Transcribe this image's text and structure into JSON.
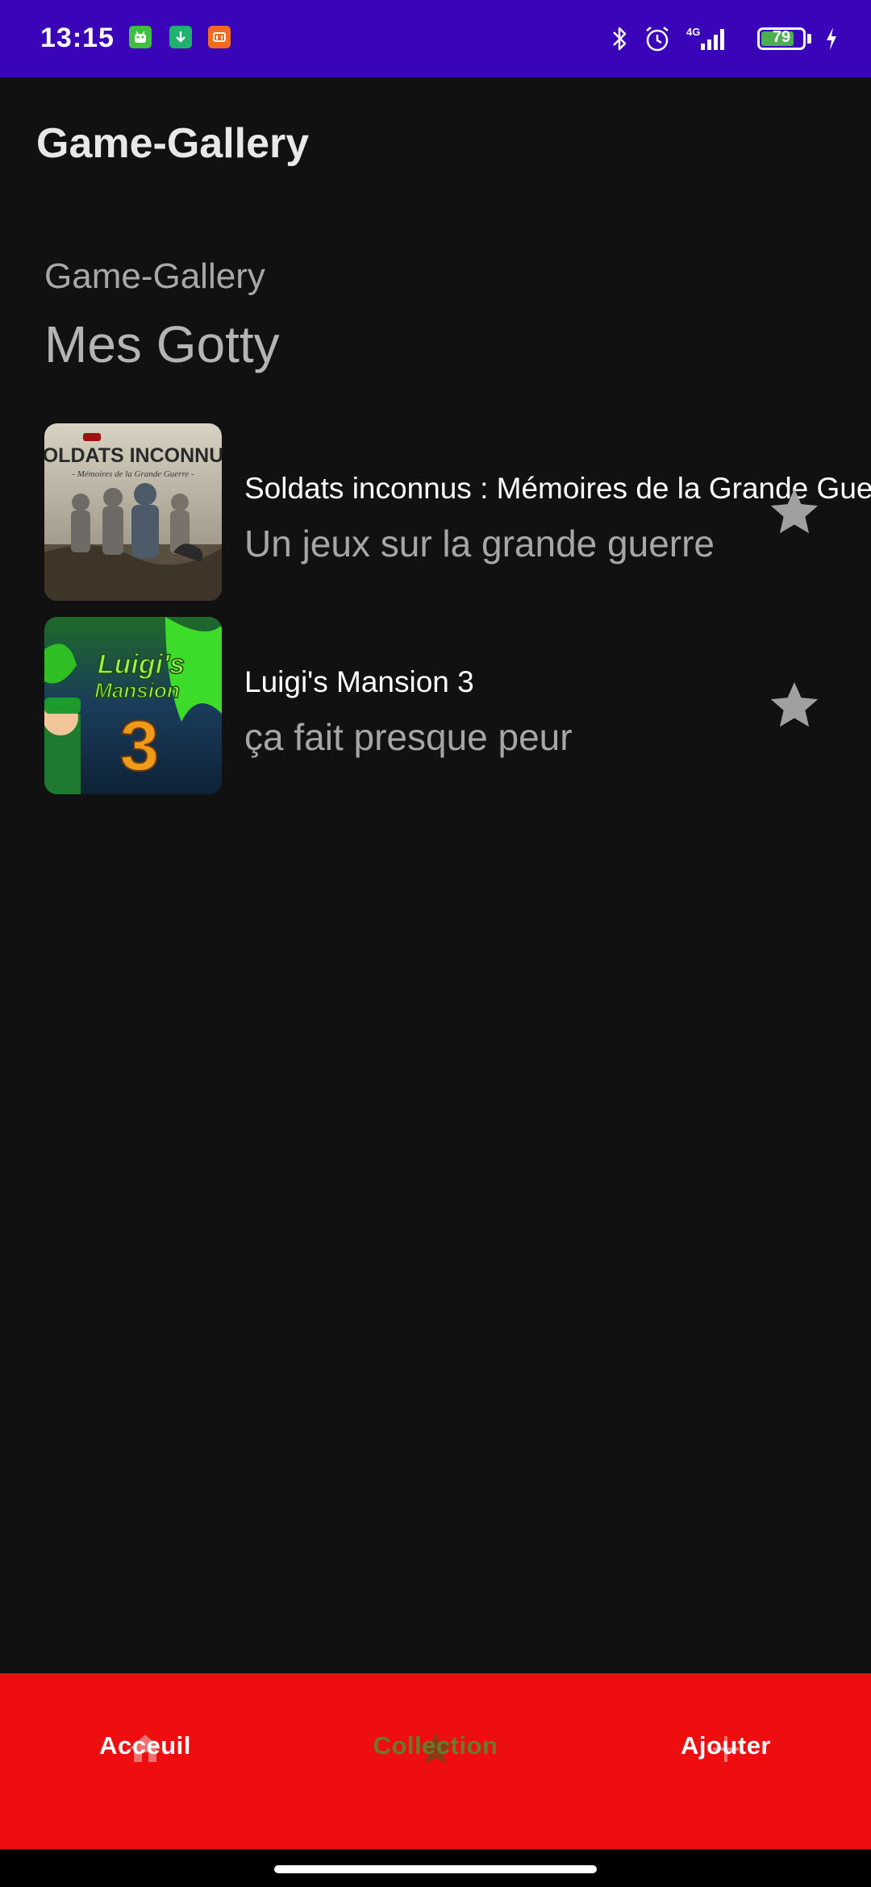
{
  "status_bar": {
    "time": "13:15",
    "network": "4G",
    "battery_level": "79",
    "battery_fraction": 0.79,
    "icons": [
      "android-notification-icon",
      "download-notification-icon",
      "mi-notification-icon",
      "bluetooth-icon",
      "alarm-icon",
      "signal-icon",
      "battery-icon",
      "charging-icon"
    ]
  },
  "app_bar": {
    "title": "Game-Gallery"
  },
  "header": {
    "subtitle": "Game-Gallery",
    "heading": "Mes Gotty"
  },
  "games": [
    {
      "title": "Soldats inconnus : Mémoires de la Grande Guerre",
      "description": "Un jeux sur la grande guerre",
      "cover_text": "SOLDATS INCONNUS",
      "cover_subtext": "- Mémoires de la Grande Guerre -",
      "favorite_icon": "star-icon"
    },
    {
      "title": "Luigi's Mansion 3",
      "description": "ça fait presque peur",
      "cover_text": "Luigi's",
      "cover_text_2": "Mansion",
      "cover_number": "3",
      "favorite_icon": "star-icon"
    }
  ],
  "bottom_nav": {
    "items": [
      {
        "label": "Acceuil",
        "icon": "home-icon",
        "active": false
      },
      {
        "label": "Collection",
        "icon": "star-icon",
        "active": true
      },
      {
        "label": "Ajouter",
        "icon": "plus-icon",
        "active": false
      }
    ]
  },
  "colors": {
    "status_bar": "#3a05b8",
    "background": "#111111",
    "bottom_nav": "#ee0e10",
    "nav_active": "#6b7a2a",
    "nav_inactive": "#ffffff",
    "star": "#a0a0a0"
  }
}
